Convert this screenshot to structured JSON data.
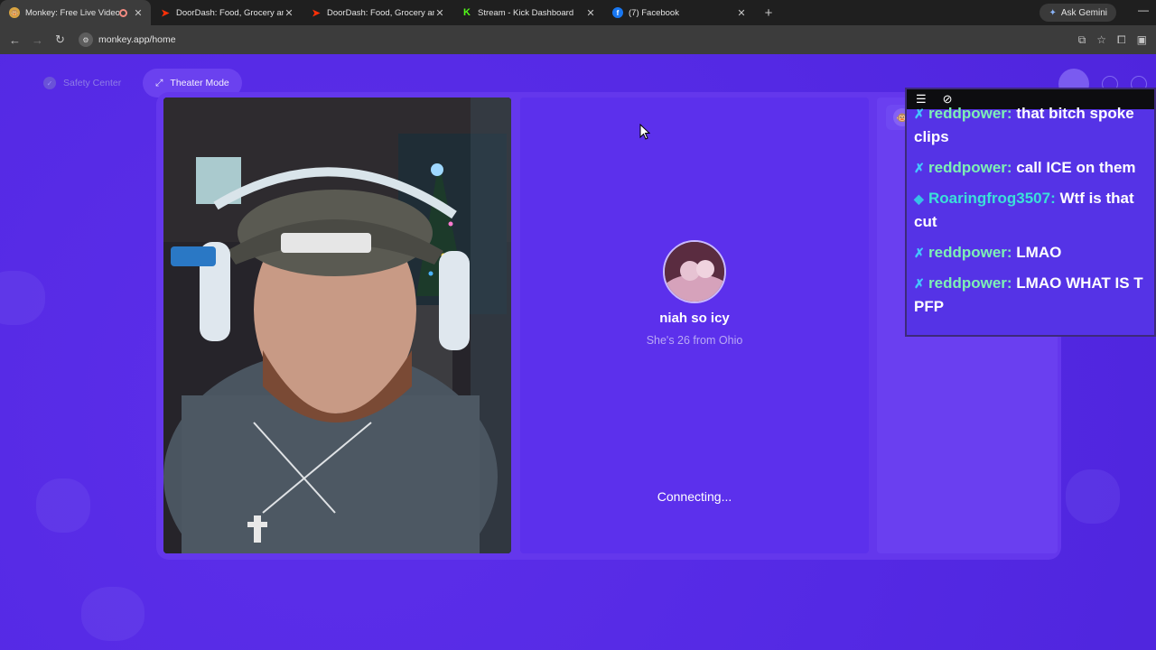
{
  "browser": {
    "tabs": [
      {
        "title": "Monkey: Free Live Video Ch",
        "active": true,
        "favicon": "monkey-icon",
        "color": "#d9a441"
      },
      {
        "title": "DoorDash: Food, Grocery and R",
        "active": false,
        "favicon": "doordash-icon",
        "color": "#ff3008"
      },
      {
        "title": "DoorDash: Food, Grocery and R",
        "active": false,
        "favicon": "doordash-icon",
        "color": "#ff3008"
      },
      {
        "title": "Stream - Kick Dashboard",
        "active": false,
        "favicon": "kick-icon",
        "color": "#53fc18"
      },
      {
        "title": "(7) Facebook",
        "active": false,
        "favicon": "facebook-icon",
        "color": "#1877f2"
      }
    ],
    "gemini_label": "Ask Gemini",
    "url": "monkey.app/home"
  },
  "page": {
    "safety_label": "Safety Center",
    "theater_label": "Theater Mode",
    "profile": {
      "name": "niah so icy",
      "info": "She's 26 from Ohio"
    },
    "status": "Connecting..."
  },
  "chat": {
    "messages": [
      {
        "user": "reddpower:",
        "text": "that bitch spoke clips",
        "badge": "sword-icon"
      },
      {
        "user": "reddpower:",
        "text": "call ICE on them",
        "badge": "sword-icon"
      },
      {
        "user": "Roaringfrog3507:",
        "text": "Wtf is that cut",
        "badge": "diamond-icon"
      },
      {
        "user": "reddpower:",
        "text": "LMAO",
        "badge": "sword-icon"
      },
      {
        "user": "reddpower:",
        "text": "LMAO WHAT IS T PFP",
        "badge": "sword-icon"
      }
    ]
  }
}
